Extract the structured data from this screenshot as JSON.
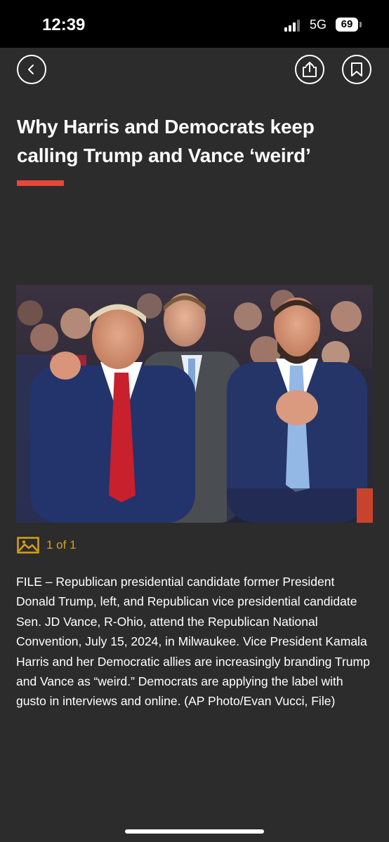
{
  "status_bar": {
    "time": "12:39",
    "network": "5G",
    "battery": "69"
  },
  "toolbar": {
    "back_icon": "chevron-left-icon",
    "share_icon": "share-icon",
    "bookmark_icon": "bookmark-icon"
  },
  "article": {
    "headline": "Why Harris and Democrats keep calling Trump and Vance ‘weird’",
    "accent_color": "#e8463a",
    "gallery": {
      "icon": "image-icon",
      "count_text": "1 of 1",
      "color": "#d4a017"
    },
    "caption": "FILE – Republican presidential candidate former President Donald Trump, left, and Republican vice presidential candidate Sen. JD Vance, R-Ohio, attend the Republican National Convention, July 15, 2024, in Milwaukee. Vice President Kamala Harris and her Democratic allies are increasingly branding Trump and Vance as “weird.” Democrats are applying the label with gusto in interviews and online. (AP Photo/Evan Vucci, File)"
  },
  "colors": {
    "background": "#2c2c2c",
    "status_bar": "#000000",
    "text": "#ffffff"
  }
}
